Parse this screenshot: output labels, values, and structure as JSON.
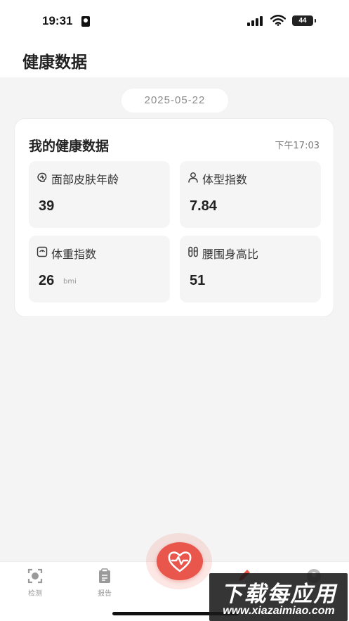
{
  "status_bar": {
    "time": "19:31",
    "battery": "44",
    "icons": [
      "id-card-icon",
      "signal-icon",
      "wifi-icon",
      "battery-icon"
    ]
  },
  "header": {
    "title": "健康数据"
  },
  "date": "2025-05-22",
  "health_card": {
    "title": "我的健康数据",
    "time": "下午17:03",
    "metrics": [
      {
        "icon": "face-icon",
        "label": "面部皮肤年龄",
        "value": "39",
        "unit": ""
      },
      {
        "icon": "person-icon",
        "label": "体型指数",
        "value": "7.84",
        "unit": ""
      },
      {
        "icon": "scale-icon",
        "label": "体重指数",
        "value": "26",
        "unit": "bmi"
      },
      {
        "icon": "waist-icon",
        "label": "腰围身高比",
        "value": "51",
        "unit": ""
      }
    ]
  },
  "tabbar": {
    "tabs": [
      {
        "icon": "scan-icon",
        "label": "检测"
      },
      {
        "icon": "clipboard-icon",
        "label": "报告"
      },
      {
        "icon": "heart-pulse-icon",
        "label": ""
      },
      {
        "icon": "pen-icon",
        "label": ""
      },
      {
        "icon": "profile-icon",
        "label": ""
      }
    ]
  },
  "watermark": {
    "title": "下载每应用",
    "url": "www.xiazaimiao.com"
  },
  "colors": {
    "accent": "#e8564c",
    "background": "#f4f4f4",
    "card": "#ffffff",
    "metric_bg": "#f5f5f5"
  }
}
